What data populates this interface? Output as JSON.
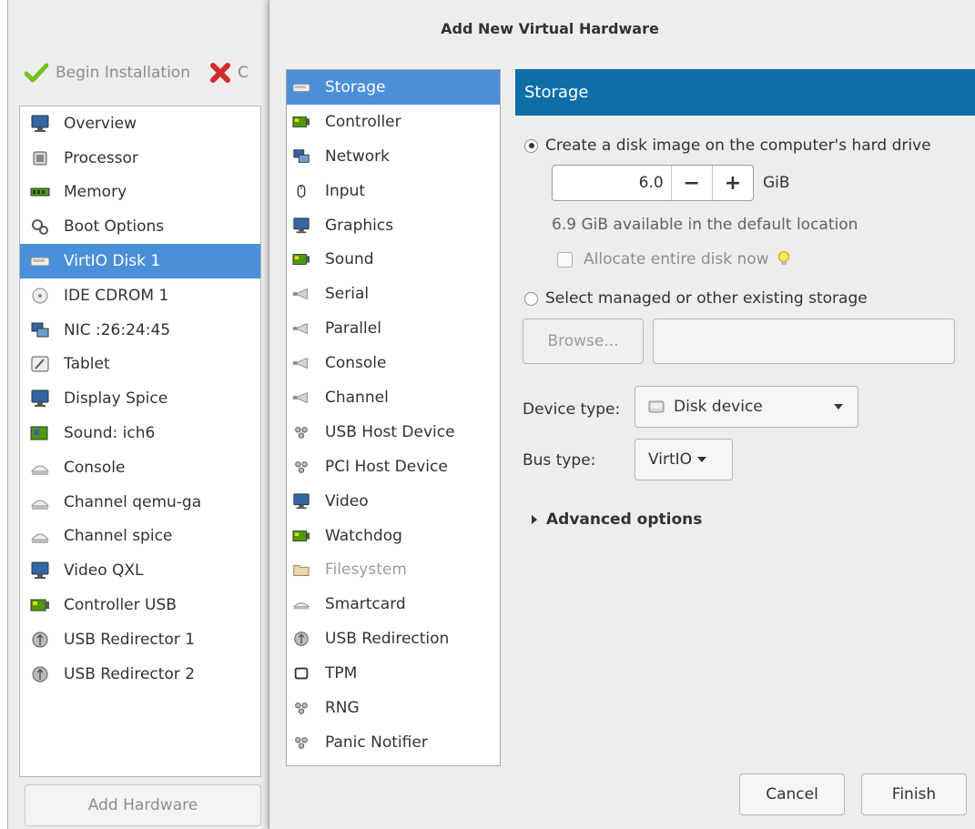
{
  "toolbar": {
    "begin_installation": "Begin Installation",
    "cancel_partial": "C"
  },
  "hardware_list": [
    {
      "label": "Overview",
      "icon": "monitor-icon"
    },
    {
      "label": "Processor",
      "icon": "cpu-icon"
    },
    {
      "label": "Memory",
      "icon": "memory-icon"
    },
    {
      "label": "Boot Options",
      "icon": "gears-icon"
    },
    {
      "label": "VirtIO Disk 1",
      "icon": "disk-icon",
      "selected": true
    },
    {
      "label": "IDE CDROM 1",
      "icon": "cdrom-icon"
    },
    {
      "label": "NIC :26:24:45",
      "icon": "network-icon"
    },
    {
      "label": "Tablet",
      "icon": "tablet-icon"
    },
    {
      "label": "Display Spice",
      "icon": "monitor-icon"
    },
    {
      "label": "Sound: ich6",
      "icon": "soundcard-icon"
    },
    {
      "label": "Console",
      "icon": "serial-icon"
    },
    {
      "label": "Channel qemu-ga",
      "icon": "serial-icon"
    },
    {
      "label": "Channel spice",
      "icon": "serial-icon"
    },
    {
      "label": "Video QXL",
      "icon": "monitor-icon"
    },
    {
      "label": "Controller USB",
      "icon": "card-icon"
    },
    {
      "label": "USB Redirector 1",
      "icon": "usb-icon"
    },
    {
      "label": "USB Redirector 2",
      "icon": "usb-icon"
    }
  ],
  "add_hardware_label": "Add Hardware",
  "dialog": {
    "title": "Add New Virtual Hardware",
    "device_types": [
      {
        "label": "Storage",
        "icon": "disk-icon",
        "selected": true
      },
      {
        "label": "Controller",
        "icon": "card-icon"
      },
      {
        "label": "Network",
        "icon": "network-icon"
      },
      {
        "label": "Input",
        "icon": "mouse-icon"
      },
      {
        "label": "Graphics",
        "icon": "monitor-icon"
      },
      {
        "label": "Sound",
        "icon": "card-icon"
      },
      {
        "label": "Serial",
        "icon": "plug-icon"
      },
      {
        "label": "Parallel",
        "icon": "plug-icon"
      },
      {
        "label": "Console",
        "icon": "plug-icon"
      },
      {
        "label": "Channel",
        "icon": "plug-icon"
      },
      {
        "label": "USB Host Device",
        "icon": "device-icon"
      },
      {
        "label": "PCI Host Device",
        "icon": "device-icon"
      },
      {
        "label": "Video",
        "icon": "monitor-icon"
      },
      {
        "label": "Watchdog",
        "icon": "card-icon"
      },
      {
        "label": "Filesystem",
        "icon": "folder-icon",
        "disabled": true
      },
      {
        "label": "Smartcard",
        "icon": "smartcard-icon"
      },
      {
        "label": "USB Redirection",
        "icon": "usb-icon"
      },
      {
        "label": "TPM",
        "icon": "chip-icon"
      },
      {
        "label": "RNG",
        "icon": "device-icon"
      },
      {
        "label": "Panic Notifier",
        "icon": "device-icon"
      }
    ],
    "storage": {
      "header": "Storage",
      "create_disk_label": "Create a disk image on the computer's hard drive",
      "size_value": "6.0",
      "minus": "−",
      "plus": "+",
      "unit": "GiB",
      "available_note": "6.9 GiB available in the default location",
      "allocate_label": "Allocate entire disk now",
      "select_existing_label": "Select managed or other existing storage",
      "browse_label": "Browse...",
      "path_value": "",
      "device_type_label": "Device type:",
      "device_type_value": "Disk device",
      "bus_type_label": "Bus type:",
      "bus_type_value": "VirtIO",
      "advanced_label": "Advanced options"
    },
    "cancel_label": "Cancel",
    "finish_label": "Finish"
  },
  "colors": {
    "selection": "#4a90d9",
    "header": "#0f6ea8"
  }
}
